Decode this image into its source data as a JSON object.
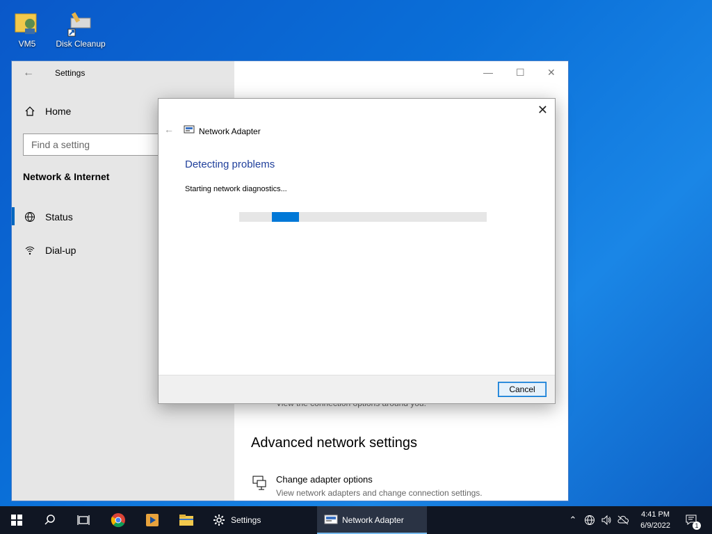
{
  "desktop": {
    "icons": [
      {
        "label": "VM5"
      },
      {
        "label": "Disk Cleanup"
      }
    ]
  },
  "settings": {
    "title": "Settings",
    "home_label": "Home",
    "search_placeholder": "Find a setting",
    "section_title": "Network & Internet",
    "nav": [
      {
        "label": "Status"
      },
      {
        "label": "Dial-up"
      }
    ],
    "connection_text": "View the connection options around you.",
    "advanced_title": "Advanced network settings",
    "adapter_title": "Change adapter options",
    "adapter_desc": "View network adapters and change connection settings."
  },
  "dialog": {
    "header_title": "Network Adapter",
    "main_title": "Detecting problems",
    "status_text": "Starting network diagnostics...",
    "cancel_label": "Cancel"
  },
  "taskbar": {
    "apps": [
      {
        "label": "Settings"
      },
      {
        "label": "Network Adapter"
      }
    ],
    "time": "4:41 PM",
    "date": "6/9/2022",
    "notification_count": "1"
  },
  "colors": {
    "accent": "#0078d7",
    "dialog_title": "#1f3f9b"
  }
}
